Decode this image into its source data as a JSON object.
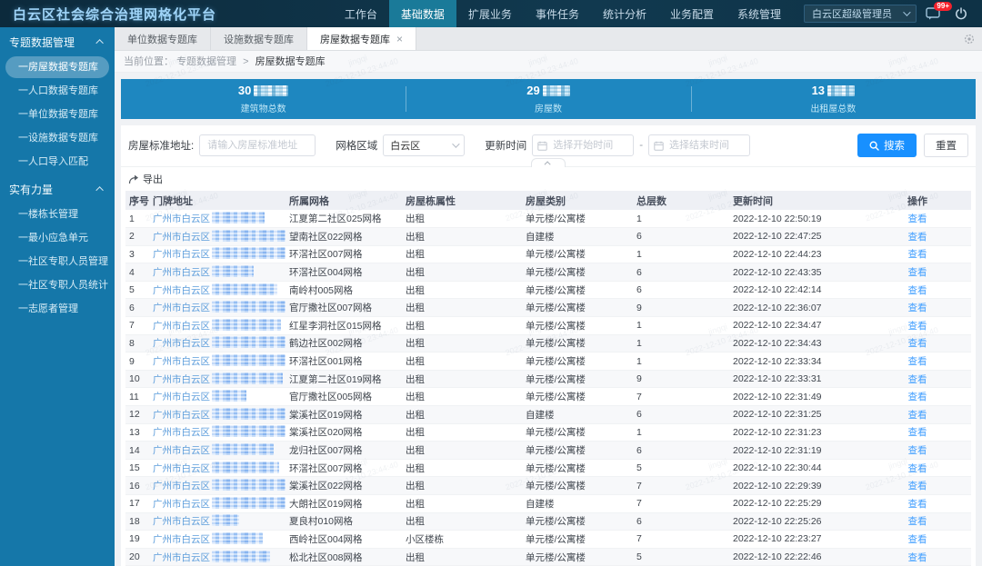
{
  "app": {
    "title": "白云区社会综合治理网格化平台"
  },
  "topnav": {
    "items": [
      {
        "label": "工作台",
        "active": false
      },
      {
        "label": "基础数据",
        "active": true
      },
      {
        "label": "扩展业务",
        "active": false
      },
      {
        "label": "事件任务",
        "active": false
      },
      {
        "label": "统计分析",
        "active": false
      },
      {
        "label": "业务配置",
        "active": false
      },
      {
        "label": "系统管理",
        "active": false
      }
    ],
    "user": "白云区超级管理员",
    "badge": "99+"
  },
  "sidebar": {
    "sections": [
      {
        "title": "专题数据管理",
        "items": [
          {
            "label": "一房屋数据专题库",
            "active": true
          },
          {
            "label": "一人口数据专题库",
            "active": false
          },
          {
            "label": "一单位数据专题库",
            "active": false
          },
          {
            "label": "一设施数据专题库",
            "active": false
          },
          {
            "label": "一人口导入匹配",
            "active": false
          }
        ]
      },
      {
        "title": "实有力量",
        "items": [
          {
            "label": "一楼栋长管理",
            "active": false
          },
          {
            "label": "一最小应急单元",
            "active": false
          },
          {
            "label": "一社区专职人员管理",
            "active": false
          },
          {
            "label": "一社区专职人员统计",
            "active": false
          },
          {
            "label": "一志愿者管理",
            "active": false
          }
        ]
      }
    ]
  },
  "tabs": {
    "items": [
      {
        "label": "单位数据专题库",
        "active": false,
        "closable": false
      },
      {
        "label": "设施数据专题库",
        "active": false,
        "closable": false
      },
      {
        "label": "房屋数据专题库",
        "active": true,
        "closable": true
      }
    ]
  },
  "breadcrumb": {
    "prefix": "当前位置：",
    "section": "专题数据管理",
    "separator": ">",
    "page": "房屋数据专题库"
  },
  "stats": [
    {
      "value": "30",
      "redacted": true,
      "redact_width": 38,
      "label": "建筑物总数"
    },
    {
      "value": "29",
      "redacted": true,
      "redact_width": 30,
      "label": "房屋数"
    },
    {
      "value": "13",
      "redacted": true,
      "redact_width": 30,
      "label": "出租屋总数"
    }
  ],
  "filters": {
    "address_label": "房屋标准地址:",
    "address_placeholder": "请输入房屋标准地址",
    "grid_label": "网格区域",
    "grid_value": "白云区",
    "time_label": "更新时间",
    "start_placeholder": "选择开始时间",
    "end_placeholder": "选择结束时间",
    "range_separator": "-",
    "search_label": "搜索",
    "reset_label": "重置"
  },
  "toolbar": {
    "export_label": "导出"
  },
  "table": {
    "columns": [
      "序号",
      "门牌地址",
      "所属网格",
      "房屋栋属性",
      "房屋类别",
      "总层数",
      "更新时间",
      "操作"
    ],
    "address_prefix": "广州市白云区",
    "action_label": "查看",
    "rows": [
      {
        "no": "1",
        "grid": "江夏第二社区025网格",
        "attr": "出租",
        "type": "单元楼/公寓楼",
        "floors": "1",
        "updated": "2022-12-10 22:50:19",
        "blur": 58
      },
      {
        "no": "2",
        "grid": "望南社区022网格",
        "attr": "出租",
        "type": "自建楼",
        "floors": "6",
        "updated": "2022-12-10 22:47:25",
        "blur": 92,
        "suffix": "号"
      },
      {
        "no": "3",
        "grid": "环滘社区007网格",
        "attr": "出租",
        "type": "单元楼/公寓楼",
        "floors": "1",
        "updated": "2022-12-10 22:44:23",
        "blur": 88
      },
      {
        "no": "4",
        "grid": "环滘社区004网格",
        "attr": "出租",
        "type": "单元楼/公寓楼",
        "floors": "6",
        "updated": "2022-12-10 22:43:35",
        "blur": 46
      },
      {
        "no": "5",
        "grid": "南岭村005网格",
        "attr": "出租",
        "type": "单元楼/公寓楼",
        "floors": "6",
        "updated": "2022-12-10 22:42:14",
        "blur": 72
      },
      {
        "no": "6",
        "grid": "官厅撒社区007网格",
        "attr": "出租",
        "type": "单元楼/公寓楼",
        "floors": "9",
        "updated": "2022-12-10 22:36:07",
        "blur": 98
      },
      {
        "no": "7",
        "grid": "红星李洞社区015网格",
        "attr": "出租",
        "type": "单元楼/公寓楼",
        "floors": "1",
        "updated": "2022-12-10 22:34:47",
        "blur": 76
      },
      {
        "no": "8",
        "grid": "鹤边社区002网格",
        "attr": "出租",
        "type": "单元楼/公寓楼",
        "floors": "1",
        "updated": "2022-12-10 22:34:43",
        "blur": 90
      },
      {
        "no": "9",
        "grid": "环滘社区001网格",
        "attr": "出租",
        "type": "单元楼/公寓楼",
        "floors": "1",
        "updated": "2022-12-10 22:33:34",
        "blur": 92
      },
      {
        "no": "10",
        "grid": "江夏第二社区019网格",
        "attr": "出租",
        "type": "单元楼/公寓楼",
        "floors": "9",
        "updated": "2022-12-10 22:33:31",
        "blur": 78
      },
      {
        "no": "11",
        "grid": "官厅撒社区005网格",
        "attr": "出租",
        "type": "单元楼/公寓楼",
        "floors": "7",
        "updated": "2022-12-10 22:31:49",
        "blur": 38
      },
      {
        "no": "12",
        "grid": "棠溪社区019网格",
        "attr": "出租",
        "type": "自建楼",
        "floors": "6",
        "updated": "2022-12-10 22:31:25",
        "blur": 86
      },
      {
        "no": "13",
        "grid": "棠溪社区020网格",
        "attr": "出租",
        "type": "单元楼/公寓楼",
        "floors": "1",
        "updated": "2022-12-10 22:31:23",
        "blur": 90
      },
      {
        "no": "14",
        "grid": "龙归社区007网格",
        "attr": "出租",
        "type": "单元楼/公寓楼",
        "floors": "6",
        "updated": "2022-12-10 22:31:19",
        "blur": 68
      },
      {
        "no": "15",
        "grid": "环滘社区007网格",
        "attr": "出租",
        "type": "单元楼/公寓楼",
        "floors": "5",
        "updated": "2022-12-10 22:30:44",
        "blur": 74
      },
      {
        "no": "16",
        "grid": "棠溪社区022网格",
        "attr": "出租",
        "type": "单元楼/公寓楼",
        "floors": "7",
        "updated": "2022-12-10 22:29:39",
        "blur": 94
      },
      {
        "no": "17",
        "grid": "大朗社区019网格",
        "attr": "出租",
        "type": "自建楼",
        "floors": "7",
        "updated": "2022-12-10 22:25:29",
        "blur": 84
      },
      {
        "no": "18",
        "grid": "夏良村010网格",
        "attr": "出租",
        "type": "单元楼/公寓楼",
        "floors": "6",
        "updated": "2022-12-10 22:25:26",
        "blur": 30
      },
      {
        "no": "19",
        "grid": "西岭社区004网格",
        "attr": "小区楼栋",
        "type": "单元楼/公寓楼",
        "floors": "7",
        "updated": "2022-12-10 22:23:27",
        "blur": 56
      },
      {
        "no": "20",
        "grid": "松北社区008网格",
        "attr": "出租",
        "type": "单元楼/公寓楼",
        "floors": "5",
        "updated": "2022-12-10 22:22:46",
        "blur": 64
      }
    ]
  },
  "watermark": {
    "name": "jingqi",
    "time": "2022-12-10 23:44:40"
  },
  "icons": {
    "search": "magnifier",
    "calendar": "calendar",
    "export": "share-arrow",
    "message": "chat-bubble",
    "power": "power",
    "gear": "gear",
    "close": "x",
    "chevron_up": "chevron-up",
    "chevron_down": "chevron-down"
  },
  "colors": {
    "topbar": "#0e3246",
    "topbar_active": "#1a7a99",
    "sidebar": "#1577a9",
    "banner": "#1e87c0",
    "accent": "#1890ff",
    "link": "#409eff",
    "address_text": "#5b9cdb",
    "badge": "#f5222d"
  }
}
